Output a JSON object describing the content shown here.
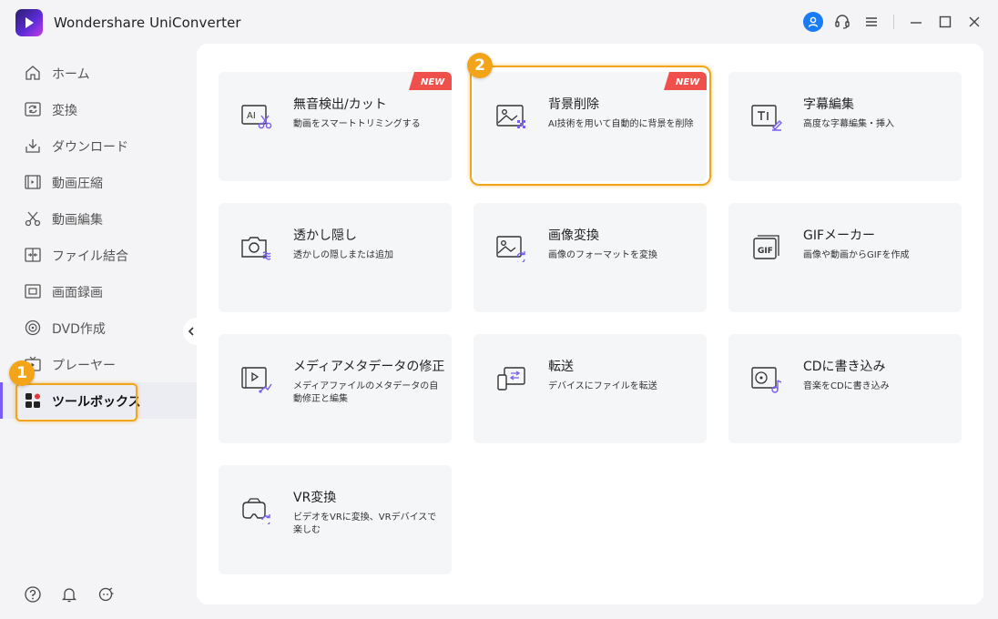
{
  "app": {
    "title": "Wondershare UniConverter"
  },
  "titlebar": {
    "icons": [
      "user-icon",
      "headset-icon",
      "menu-icon",
      "minimize-icon",
      "maximize-icon",
      "close-icon"
    ],
    "accent": "#1a7cf5"
  },
  "sidebar": {
    "items": [
      {
        "label": "ホーム",
        "icon": "home-icon"
      },
      {
        "label": "変換",
        "icon": "convert-icon"
      },
      {
        "label": "ダウンロード",
        "icon": "download-icon"
      },
      {
        "label": "動画圧縮",
        "icon": "compress-icon"
      },
      {
        "label": "動画編集",
        "icon": "scissors-icon"
      },
      {
        "label": "ファイル結合",
        "icon": "merge-icon"
      },
      {
        "label": "画面録画",
        "icon": "screen-record-icon"
      },
      {
        "label": "DVD作成",
        "icon": "dvd-icon"
      },
      {
        "label": "プレーヤー",
        "icon": "tv-icon"
      },
      {
        "label": "ツールボックス",
        "icon": "toolbox-icon",
        "active": true
      }
    ],
    "bottom_icons": [
      "help-icon",
      "bell-icon",
      "feedback-icon"
    ]
  },
  "annotations": {
    "badge1": "1",
    "badge2": "2",
    "color": "#f3a418"
  },
  "tools": [
    {
      "title": "無音検出/カット",
      "desc": "動画をスマートトリミングする",
      "icon": "ai-cut-icon",
      "new": true
    },
    {
      "title": "背景削除",
      "desc": "AI技術を用いて自動的に背景を削除",
      "icon": "bg-remove-icon",
      "new": true
    },
    {
      "title": "字幕編集",
      "desc": "高度な字幕編集・挿入",
      "icon": "subtitle-icon",
      "new": false
    },
    {
      "title": "透かし隠し",
      "desc": "透かしの隠しまたは追加",
      "icon": "watermark-icon",
      "new": false
    },
    {
      "title": "画像変換",
      "desc": "画像のフォーマットを変換",
      "icon": "image-convert-icon",
      "new": false
    },
    {
      "title": "GIFメーカー",
      "desc": "画像や動画からGIFを作成",
      "icon": "gif-icon",
      "new": false
    },
    {
      "title": "メディアメタデータの修正",
      "desc": "メディアファイルのメタデータの自動修正と編集",
      "icon": "metadata-icon",
      "new": false
    },
    {
      "title": "転送",
      "desc": "デバイスにファイルを転送",
      "icon": "transfer-icon",
      "new": false
    },
    {
      "title": "CDに書き込み",
      "desc": "音楽をCDに書き込み",
      "icon": "cd-burn-icon",
      "new": false
    },
    {
      "title": "VR変換",
      "desc": "ビデオをVRに変換、VRデバイスで楽しむ",
      "icon": "vr-icon",
      "new": false
    }
  ],
  "new_label": "NEW",
  "new_color": "#f0504b"
}
